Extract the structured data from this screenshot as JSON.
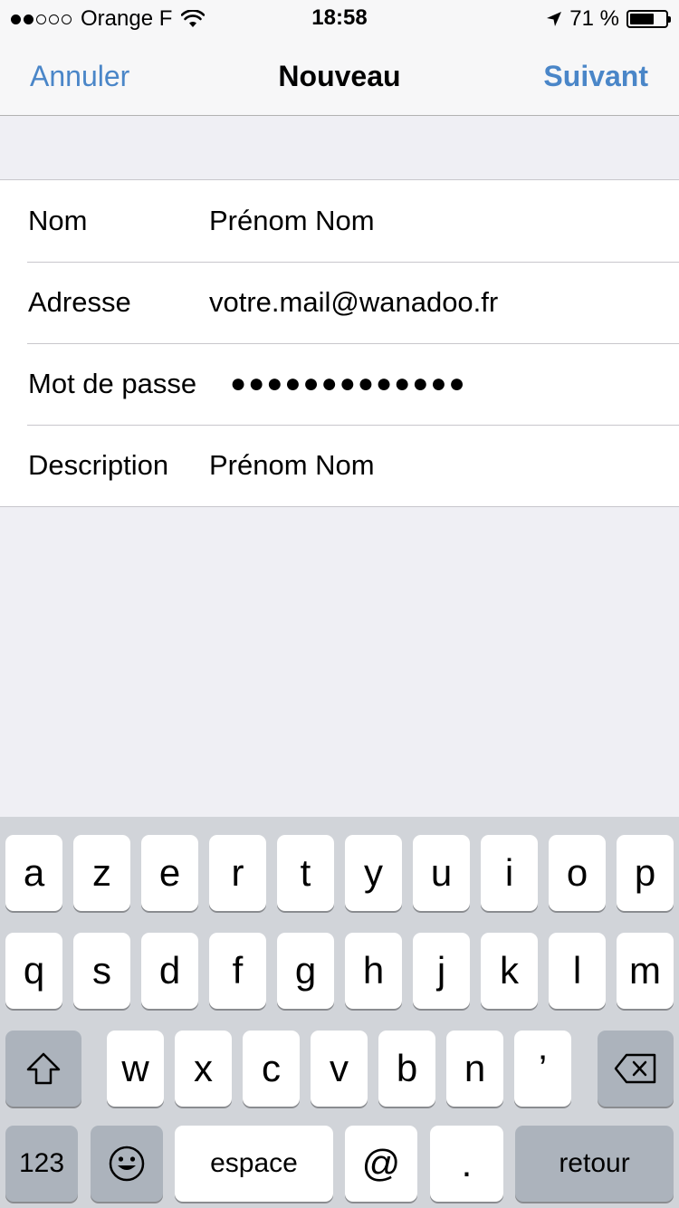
{
  "status_bar": {
    "carrier": "Orange F",
    "time": "18:58",
    "battery_percent": "71 %",
    "battery_level": 0.71,
    "signal_bars_filled": 2,
    "signal_bars_total": 5
  },
  "nav": {
    "cancel_label": "Annuler",
    "title": "Nouveau",
    "next_label": "Suivant"
  },
  "form": {
    "rows": [
      {
        "label": "Nom",
        "value": "Prénom Nom"
      },
      {
        "label": "Adresse",
        "value": "votre.mail@wanadoo.fr"
      },
      {
        "label": "Mot de passe",
        "value": "●●●●●●●●●●●●●"
      },
      {
        "label": "Description",
        "value": "Prénom Nom"
      }
    ]
  },
  "keyboard": {
    "row1": [
      "a",
      "z",
      "e",
      "r",
      "t",
      "y",
      "u",
      "i",
      "o",
      "p"
    ],
    "row2": [
      "q",
      "s",
      "d",
      "f",
      "g",
      "h",
      "j",
      "k",
      "l",
      "m"
    ],
    "row3": [
      "w",
      "x",
      "c",
      "v",
      "b",
      "n",
      "’"
    ],
    "numbers_label": "123",
    "space_label": "espace",
    "at_label": "@",
    "dot_label": ".",
    "return_label": "retour"
  },
  "colors": {
    "accent": "#4a86c8",
    "background": "#efeff4",
    "keyboard_background": "#d1d4d9"
  }
}
